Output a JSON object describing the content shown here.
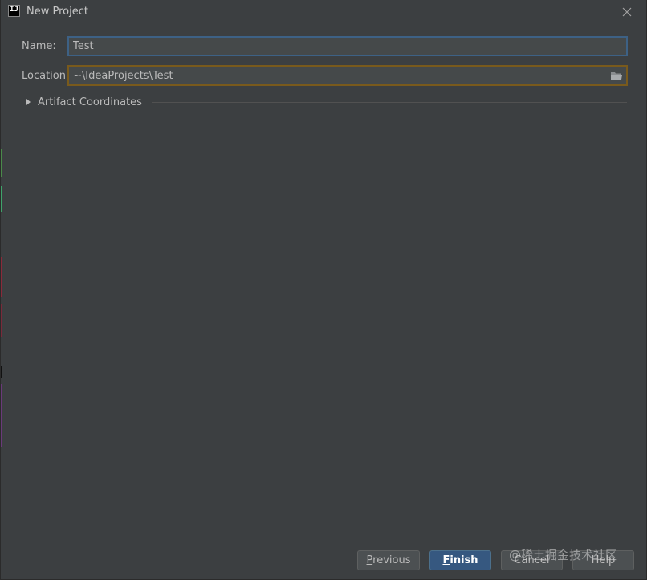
{
  "window": {
    "title": "New Project",
    "logo_text": "IJ"
  },
  "form": {
    "name_label": "Name:",
    "name_value": "Test",
    "location_label": "Location:",
    "location_value": "~\\IdeaProjects\\Test"
  },
  "artifact": {
    "label": "Artifact Coordinates",
    "expanded": false
  },
  "buttons": {
    "previous": "Previous",
    "finish": "Finish",
    "cancel": "Cancel",
    "help": "Help"
  },
  "watermark": "@稀土掘金技术社区",
  "colors": {
    "background": "#3c3f41",
    "field_background": "#45494a",
    "focus_border": "#3d6185",
    "warning_border": "#795a1c",
    "primary_button": "#365880",
    "text": "#bbbbbb"
  },
  "icons": {
    "close": "close-icon",
    "folder": "folder-icon",
    "expand": "triangle-right-icon"
  }
}
